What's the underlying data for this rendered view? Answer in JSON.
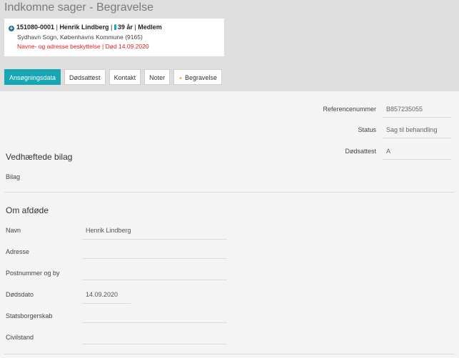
{
  "header": {
    "title": "Indkomne sager - Begravelse"
  },
  "person": {
    "id": "151080-0001",
    "name": "Henrik Lindberg",
    "age": "39 år",
    "status": "Medlem",
    "separator": "|",
    "parish": "Sydhavn Sogn, Københavns Kommune (9165)",
    "warning": "Navne- og adresse beskyttelse | Død 14.09.2020"
  },
  "tabs": [
    "Ansøgningsdata",
    "Dødsattest",
    "Kontakt",
    "Noter",
    "Begravelse"
  ],
  "case": [
    {
      "label": "Referencenummer",
      "value": "B857235055"
    },
    {
      "label": "Status",
      "value": "Sag til behandling"
    },
    {
      "label": "Dødsattest",
      "value": "A"
    }
  ],
  "attachments": {
    "title": "Vedhæftede bilag",
    "bilag_label": "Bilag"
  },
  "deceased": {
    "title": "Om afdøde",
    "fields": [
      {
        "label": "Navn",
        "value": "Henrik Lindberg"
      },
      {
        "label": "Adresse",
        "value": ""
      },
      {
        "label": "Postnummer og by",
        "value": ""
      },
      {
        "label": "Dødsdato",
        "value": "14.09.2020"
      },
      {
        "label": "Statsborgerskab",
        "value": ""
      },
      {
        "label": "Civilstand",
        "value": ""
      }
    ]
  }
}
